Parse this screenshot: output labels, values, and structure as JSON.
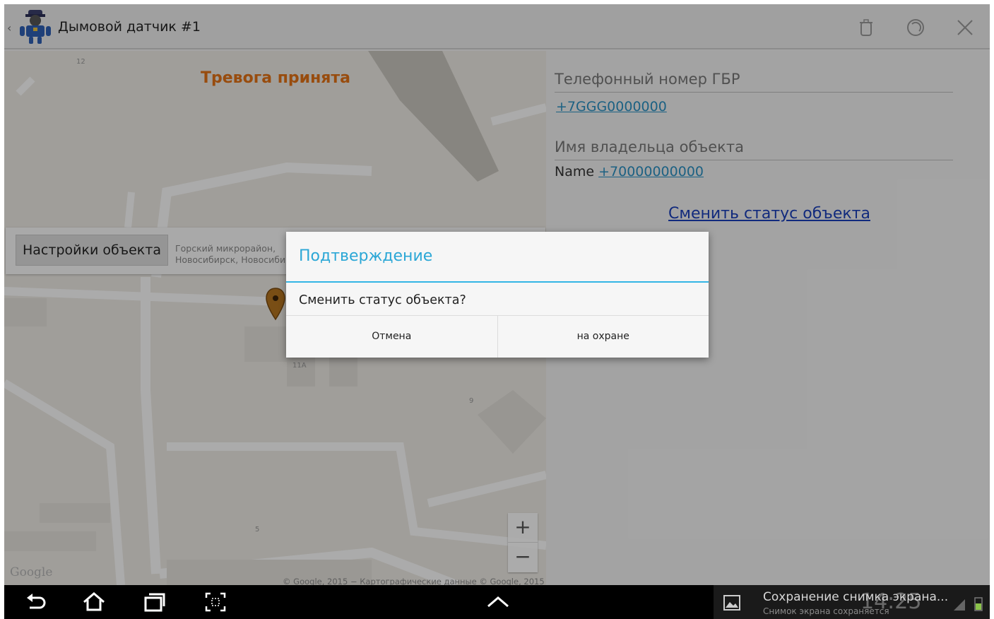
{
  "app": {
    "title": "Дымовой датчик #1"
  },
  "map": {
    "alarm_text": "Тревога принята",
    "settings_button": "Настройки объекта",
    "address_line1": "Горский микрорайон,",
    "address_line2": "Новосибирск, Новосибирская",
    "zoom_in": "+",
    "zoom_out": "−",
    "google_logo": "Google",
    "copyright": "© Google, 2015 − Картографические данные © Google, 2015",
    "street_labels": [
      "12",
      "11А",
      "9",
      "5"
    ]
  },
  "panel": {
    "gbr_phone_label": "Телефонный номер ГБР",
    "gbr_phone": "+7GGG0000000",
    "owner_label": "Имя владельца объекта",
    "owner_name": "Name",
    "owner_phone": "+70000000000",
    "change_status_link": "Сменить статус объекта"
  },
  "dialog": {
    "title": "Подтверждение",
    "message": "Сменить статус объекта?",
    "cancel_label": "Отмена",
    "confirm_label": "на охране"
  },
  "system": {
    "notification_title": "Сохранение снимка экрана...",
    "notification_subtitle": "Снимок экрана сохраняется",
    "clock": "14:25"
  },
  "colors": {
    "accent": "#33b5e5",
    "alarm": "#e07016",
    "link": "#2a8fc1",
    "status_link": "#1a3fb8"
  }
}
